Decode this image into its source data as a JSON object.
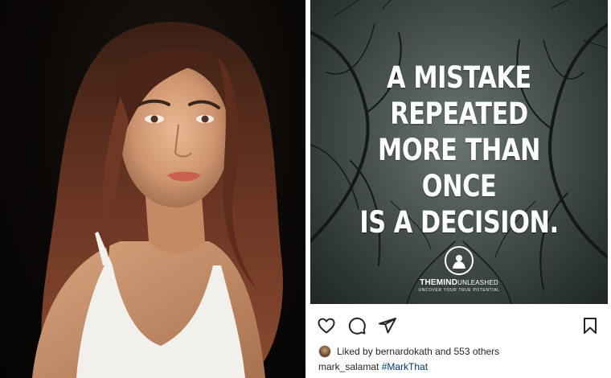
{
  "post": {
    "quote_lines": [
      "A MISTAKE REPEATED",
      "MORE THAN ONCE",
      "IS A DECISION."
    ],
    "brand_name_bold": "THEMIND",
    "brand_name_rest": "UNLEASHED",
    "brand_tagline": "UNCOVER YOUR TRUE POTENTIAL",
    "liked_prefix": "Liked by",
    "liked_user": "bernardokath",
    "liked_suffix": "and 553 others",
    "caption_user": "mark_salamat",
    "caption_hashtag": "#MarkThat"
  },
  "icons": {
    "like": "heart-icon",
    "comment": "comment-icon",
    "share": "send-icon",
    "save": "bookmark-icon"
  },
  "colors": {
    "text": "#262626",
    "hashtag": "#00376b"
  }
}
